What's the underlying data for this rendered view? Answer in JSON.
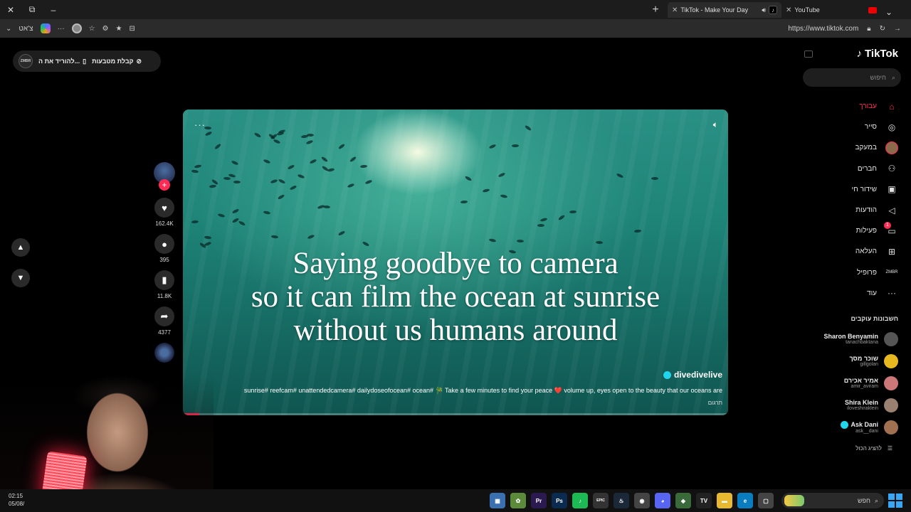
{
  "browser": {
    "window_controls": {
      "close": "✕",
      "restore": "⧉",
      "minimize": "–"
    },
    "new_tab": "+",
    "tabs": [
      {
        "title": "TikTok - Make Your Day",
        "active": true
      },
      {
        "title": "YouTube",
        "active": false
      }
    ],
    "profile_label": "צ'אט",
    "url": "https://www.tiktok.com"
  },
  "top_pill": {
    "get_coins": "קבלת מטבעות",
    "download_app": "להוריד את ה..."
  },
  "video": {
    "caption_lines": [
      "Saying goodbye to camera",
      "so it can film the ocean at sunrise",
      "without us humans around"
    ],
    "author": "divedivelive",
    "description": "sunrise# reefcam# unattendedcamera# dailydoseofocean# ocean# 🎋 Take a few minutes to find your peace ❤️ volume up, eyes open to the beauty that our oceans are",
    "translate": "תרגום",
    "progress": 0.03
  },
  "actions": {
    "likes": "162.4K",
    "comments": "395",
    "saves": "11.8K",
    "shares": "4377"
  },
  "sidebar": {
    "logo": "TikTok",
    "search_placeholder": "חיפוש",
    "nav": [
      {
        "label": "עבורך",
        "icon": "home-icon",
        "glyph": "⌂",
        "active": true
      },
      {
        "label": "סייר",
        "icon": "compass-icon",
        "glyph": "◎"
      },
      {
        "label": "במעקב",
        "icon": "following-avatar-icon",
        "glyph": ""
      },
      {
        "label": "חברים",
        "icon": "friends-icon",
        "glyph": "⚇"
      },
      {
        "label": "שידור חי",
        "icon": "live-icon",
        "glyph": "▣"
      },
      {
        "label": "הודעות",
        "icon": "messages-icon",
        "glyph": "◁"
      },
      {
        "label": "פעילות",
        "icon": "activity-icon",
        "glyph": "▭",
        "badge": "1"
      },
      {
        "label": "העלאה",
        "icon": "upload-icon",
        "glyph": "⊞"
      },
      {
        "label": "פרופיל",
        "icon": "profile-icon",
        "glyph": "ZMBR"
      },
      {
        "label": "עוד",
        "icon": "more-icon",
        "glyph": "···"
      }
    ],
    "following_title": "חשבונות עוקבים",
    "accounts": [
      {
        "name": "Sharon Benyamin",
        "handle": "tanachbaktana",
        "color": "#555"
      },
      {
        "name": "שוכר מסך",
        "handle": "gillgolan",
        "color": "#e8b820"
      },
      {
        "name": "אמיר אכירם",
        "handle": "amir_aviram",
        "color": "#c77"
      },
      {
        "name": "Shira Klein",
        "handle": "iloveshiraklein",
        "color": "#9a8070"
      },
      {
        "name": "Ask Dani",
        "handle": "ask__dani",
        "color": "#a07050",
        "verified": true
      }
    ],
    "see_all": "להציג הכול"
  },
  "taskbar": {
    "time": "02:15",
    "date": "05/08/",
    "search": "חפש",
    "apps": [
      {
        "name": "calculator-icon",
        "label": "▦",
        "color": "#3a6fb0"
      },
      {
        "name": "app-icon",
        "label": "✿",
        "color": "#5a8a3a"
      },
      {
        "name": "premiere-icon",
        "label": "Pr",
        "color": "#2a1a50"
      },
      {
        "name": "photoshop-icon",
        "label": "Ps",
        "color": "#0a2a50"
      },
      {
        "name": "spotify-icon",
        "label": "♪",
        "color": "#1db954"
      },
      {
        "name": "epic-icon",
        "label": "EPIC",
        "color": "#333"
      },
      {
        "name": "steam-icon",
        "label": "♨",
        "color": "#1b2838"
      },
      {
        "name": "chrome-icon",
        "label": "◉",
        "color": "#444"
      },
      {
        "name": "discord-icon",
        "label": "◕",
        "color": "#5865f2"
      },
      {
        "name": "app2-icon",
        "label": "◆",
        "color": "#3a6a3a"
      },
      {
        "name": "tradingview-icon",
        "label": "TV",
        "color": "#222"
      },
      {
        "name": "folder-icon",
        "label": "▬",
        "color": "#e8b830"
      },
      {
        "name": "edge-icon",
        "label": "e",
        "color": "#0a7cc0"
      },
      {
        "name": "window-icon",
        "label": "▢",
        "color": "#444"
      }
    ]
  }
}
